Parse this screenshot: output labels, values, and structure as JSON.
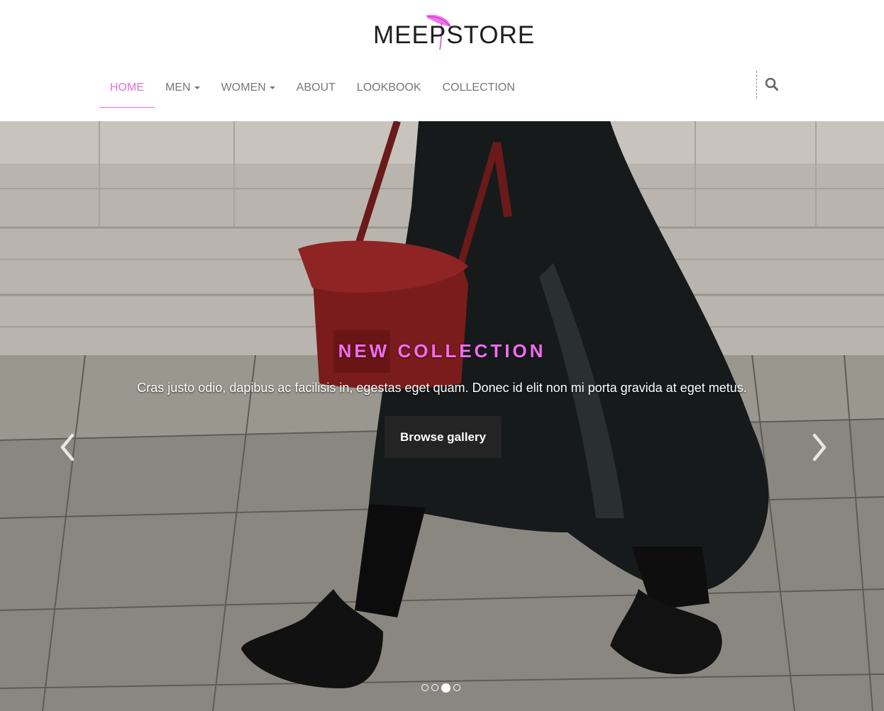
{
  "brand": {
    "name": "MEEPSTORE",
    "accent_color": "#e06fe0",
    "feather_color": "#f06be8"
  },
  "nav": {
    "items": [
      {
        "label": "HOME",
        "active": true,
        "dropdown": false
      },
      {
        "label": "MEN",
        "active": false,
        "dropdown": true
      },
      {
        "label": "WOMEN",
        "active": false,
        "dropdown": true
      },
      {
        "label": "ABOUT",
        "active": false,
        "dropdown": false
      },
      {
        "label": "LOOKBOOK",
        "active": false,
        "dropdown": false
      },
      {
        "label": "COLLECTION",
        "active": false,
        "dropdown": false
      }
    ],
    "search_icon": "search-icon"
  },
  "hero": {
    "title": "NEW COLLECTION",
    "text": "Cras justo odio, dapibus ac facilisis in, egestas eget quam. Donec id elit non mi porta gravida at eget metus.",
    "button_label": "Browse gallery",
    "prev_icon": "chevron-left-icon",
    "next_icon": "chevron-right-icon",
    "slide_count": 4,
    "active_slide": 3,
    "title_color": "#f26cf0"
  }
}
